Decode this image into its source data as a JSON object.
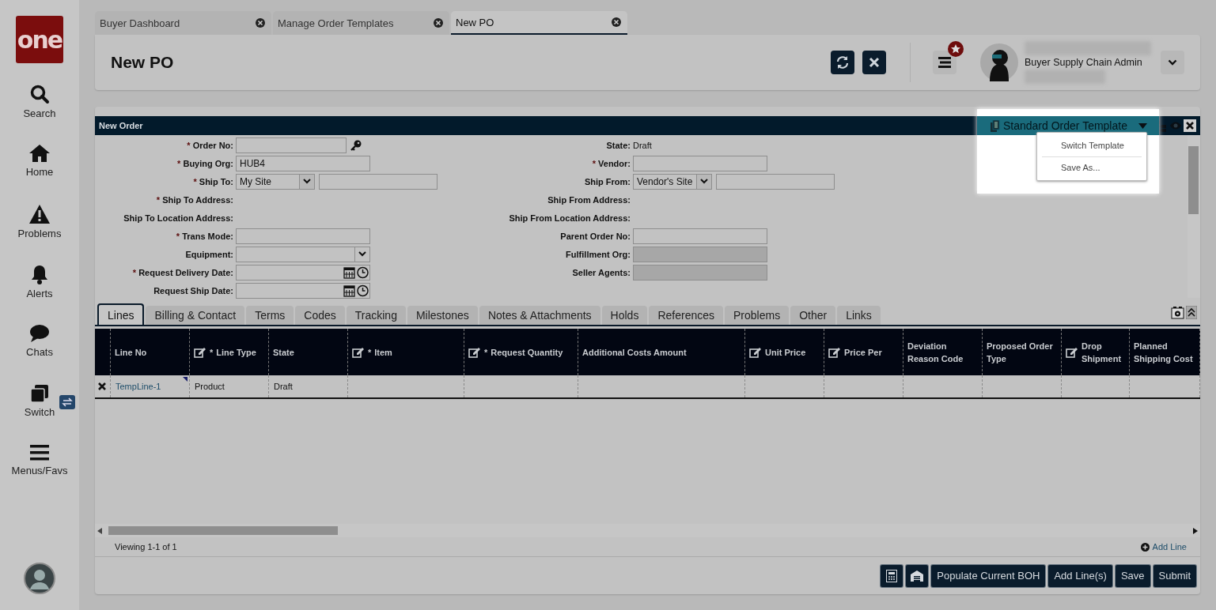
{
  "sidebar": {
    "logo": "one",
    "items": [
      {
        "kind": "search",
        "label": "Search"
      },
      {
        "kind": "home",
        "label": "Home"
      },
      {
        "kind": "problems",
        "label": "Problems"
      },
      {
        "kind": "alerts",
        "label": "Alerts"
      },
      {
        "kind": "chats",
        "label": "Chats"
      },
      {
        "kind": "switch",
        "label": "Switch"
      },
      {
        "kind": "menus",
        "label": "Menus/Favs"
      }
    ]
  },
  "tabs": [
    {
      "label": "Buyer Dashboard",
      "selected": false
    },
    {
      "label": "Manage Order Templates",
      "selected": false
    },
    {
      "label": "New PO",
      "selected": true
    }
  ],
  "page_title": "New PO",
  "user": {
    "role": "Buyer Supply Chain Admin"
  },
  "panel": {
    "title": "New Order",
    "template": "Standard Order Template",
    "template_menu": [
      "Switch Template",
      "Save As..."
    ]
  },
  "form": {
    "left": [
      {
        "asterisk": "*",
        "label": "Order No:",
        "kind": "text",
        "lookup": true
      },
      {
        "asterisk": "*",
        "label": "Buying Org:",
        "kind": "text",
        "value": "HUB4"
      },
      {
        "asterisk": "*",
        "label": "Ship To:",
        "kind": "select",
        "value": "My Site"
      },
      {
        "asterisk": "*",
        "label": "Ship To Address:",
        "kind": "none"
      },
      {
        "label": "Ship To Location Address:",
        "kind": "none"
      },
      {
        "asterisk": "*",
        "label": "Trans Mode:",
        "kind": "text"
      },
      {
        "label": "Equipment:",
        "kind": "dropdown"
      },
      {
        "asterisk": "*",
        "label": "Request Delivery Date:",
        "kind": "date"
      },
      {
        "label": "Request Ship Date:",
        "kind": "date"
      }
    ],
    "right": [
      {
        "label": "State:",
        "kind": "static",
        "value": "Draft"
      },
      {
        "asterisk": "*",
        "label": "Vendor:",
        "kind": "text"
      },
      {
        "label": "Ship From:",
        "kind": "select",
        "value": "Vendor's Site"
      },
      {
        "label": "Ship From Address:",
        "kind": "none"
      },
      {
        "label": "Ship From Location Address:",
        "kind": "none"
      },
      {
        "label": "Parent Order No:",
        "kind": "text"
      },
      {
        "label": "Fulfillment Org:",
        "kind": "disabled"
      },
      {
        "label": "Seller Agents:",
        "kind": "disabled"
      }
    ]
  },
  "detail_tabs": [
    {
      "label": "Lines",
      "selected": true
    },
    {
      "label": "Billing & Contact",
      "selected": false
    },
    {
      "label": "Terms",
      "selected": false
    },
    {
      "label": "Codes",
      "selected": false
    },
    {
      "label": "Tracking",
      "selected": false
    },
    {
      "label": "Milestones",
      "selected": false
    },
    {
      "label": "Notes & Attachments",
      "selected": false
    },
    {
      "label": "Holds",
      "selected": false
    },
    {
      "label": "References",
      "selected": false
    },
    {
      "label": "Problems",
      "selected": false
    },
    {
      "label": "Other",
      "selected": false
    },
    {
      "label": "Links",
      "selected": false
    }
  ],
  "grid": {
    "columns": [
      {
        "label": "Line No",
        "editable": false
      },
      {
        "label": "Line Type",
        "editable": true,
        "asterisk": "*"
      },
      {
        "label": "State",
        "editable": false
      },
      {
        "label": "Item",
        "editable": true,
        "asterisk": "*"
      },
      {
        "label": "Request Quantity",
        "editable": true,
        "asterisk": "*"
      },
      {
        "label": "Additional Costs Amount",
        "editable": false
      },
      {
        "label": "Unit Price",
        "editable": true
      },
      {
        "label": "Price Per",
        "editable": true
      },
      {
        "label": "Deviation Reason Code",
        "editable": false
      },
      {
        "label": "Proposed Order Type",
        "editable": false
      },
      {
        "label": "Drop Shipment",
        "editable": true
      },
      {
        "label": "Planned Shipping Cost",
        "editable": false
      }
    ],
    "rows": [
      {
        "cells": [
          "TempLine-1",
          "Product",
          "Draft"
        ]
      }
    ]
  },
  "pager": "Viewing 1-1 of 1",
  "add_line": "Add Line",
  "buttons": [
    "Populate Current BOH",
    "Add Line(s)",
    "Save",
    "Submit"
  ]
}
